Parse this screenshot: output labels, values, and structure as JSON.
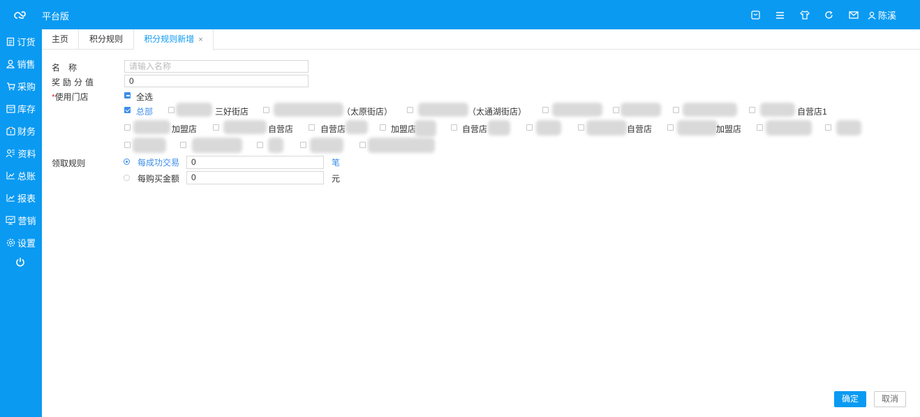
{
  "header": {
    "brand": "平台版",
    "user_name": "陈溪"
  },
  "sidebar": {
    "items": [
      {
        "label": "订货",
        "icon": "clipboard-icon"
      },
      {
        "label": "销售",
        "icon": "person-icon"
      },
      {
        "label": "采购",
        "icon": "cart-icon"
      },
      {
        "label": "库存",
        "icon": "warehouse-icon"
      },
      {
        "label": "财务",
        "icon": "finance-icon"
      },
      {
        "label": "资料",
        "icon": "people-icon"
      },
      {
        "label": "总账",
        "icon": "chart-line-icon"
      },
      {
        "label": "报表",
        "icon": "chart-line-icon"
      },
      {
        "label": "营销",
        "icon": "monitor-icon"
      },
      {
        "label": "设置",
        "icon": "gear-icon"
      }
    ]
  },
  "tabs": [
    {
      "label": "主页"
    },
    {
      "label": "积分规则"
    },
    {
      "label": "积分规则新增",
      "close": "×"
    }
  ],
  "form": {
    "name_label": "名　称",
    "name_placeholder": "请输入名称",
    "reward_label": "奖励分值",
    "reward_value": "0",
    "required_mark": "*",
    "stores_label": "使用门店",
    "select_all": "全选",
    "stores": [
      {
        "label": "总部",
        "checked": true
      },
      {
        "label": "三好街店",
        "checked": false
      },
      {
        "label": "（太原街店）",
        "checked": false
      },
      {
        "label": "（太通湖街店）",
        "checked": false
      },
      {
        "label": "自营店1",
        "checked": false
      },
      {
        "label": "加盟店",
        "checked": false
      },
      {
        "label": "自营店",
        "checked": false
      },
      {
        "label": "自营店",
        "checked": false
      },
      {
        "label": "加盟店",
        "checked": false
      },
      {
        "label": "自营店",
        "checked": false
      },
      {
        "label": "自营店",
        "checked": false
      },
      {
        "label": "加盟店",
        "checked": false
      }
    ],
    "rule_label": "领取规则",
    "rule_options": [
      {
        "label": "每成功交易",
        "value": "0",
        "unit": "笔",
        "selected": true
      },
      {
        "label": "每购买金额",
        "value": "0",
        "unit": "元",
        "selected": false
      }
    ]
  },
  "footer": {
    "confirm": "确定",
    "cancel": "取消"
  },
  "colors": {
    "primary": "#0a9af2",
    "link": "#3d8ee8"
  }
}
